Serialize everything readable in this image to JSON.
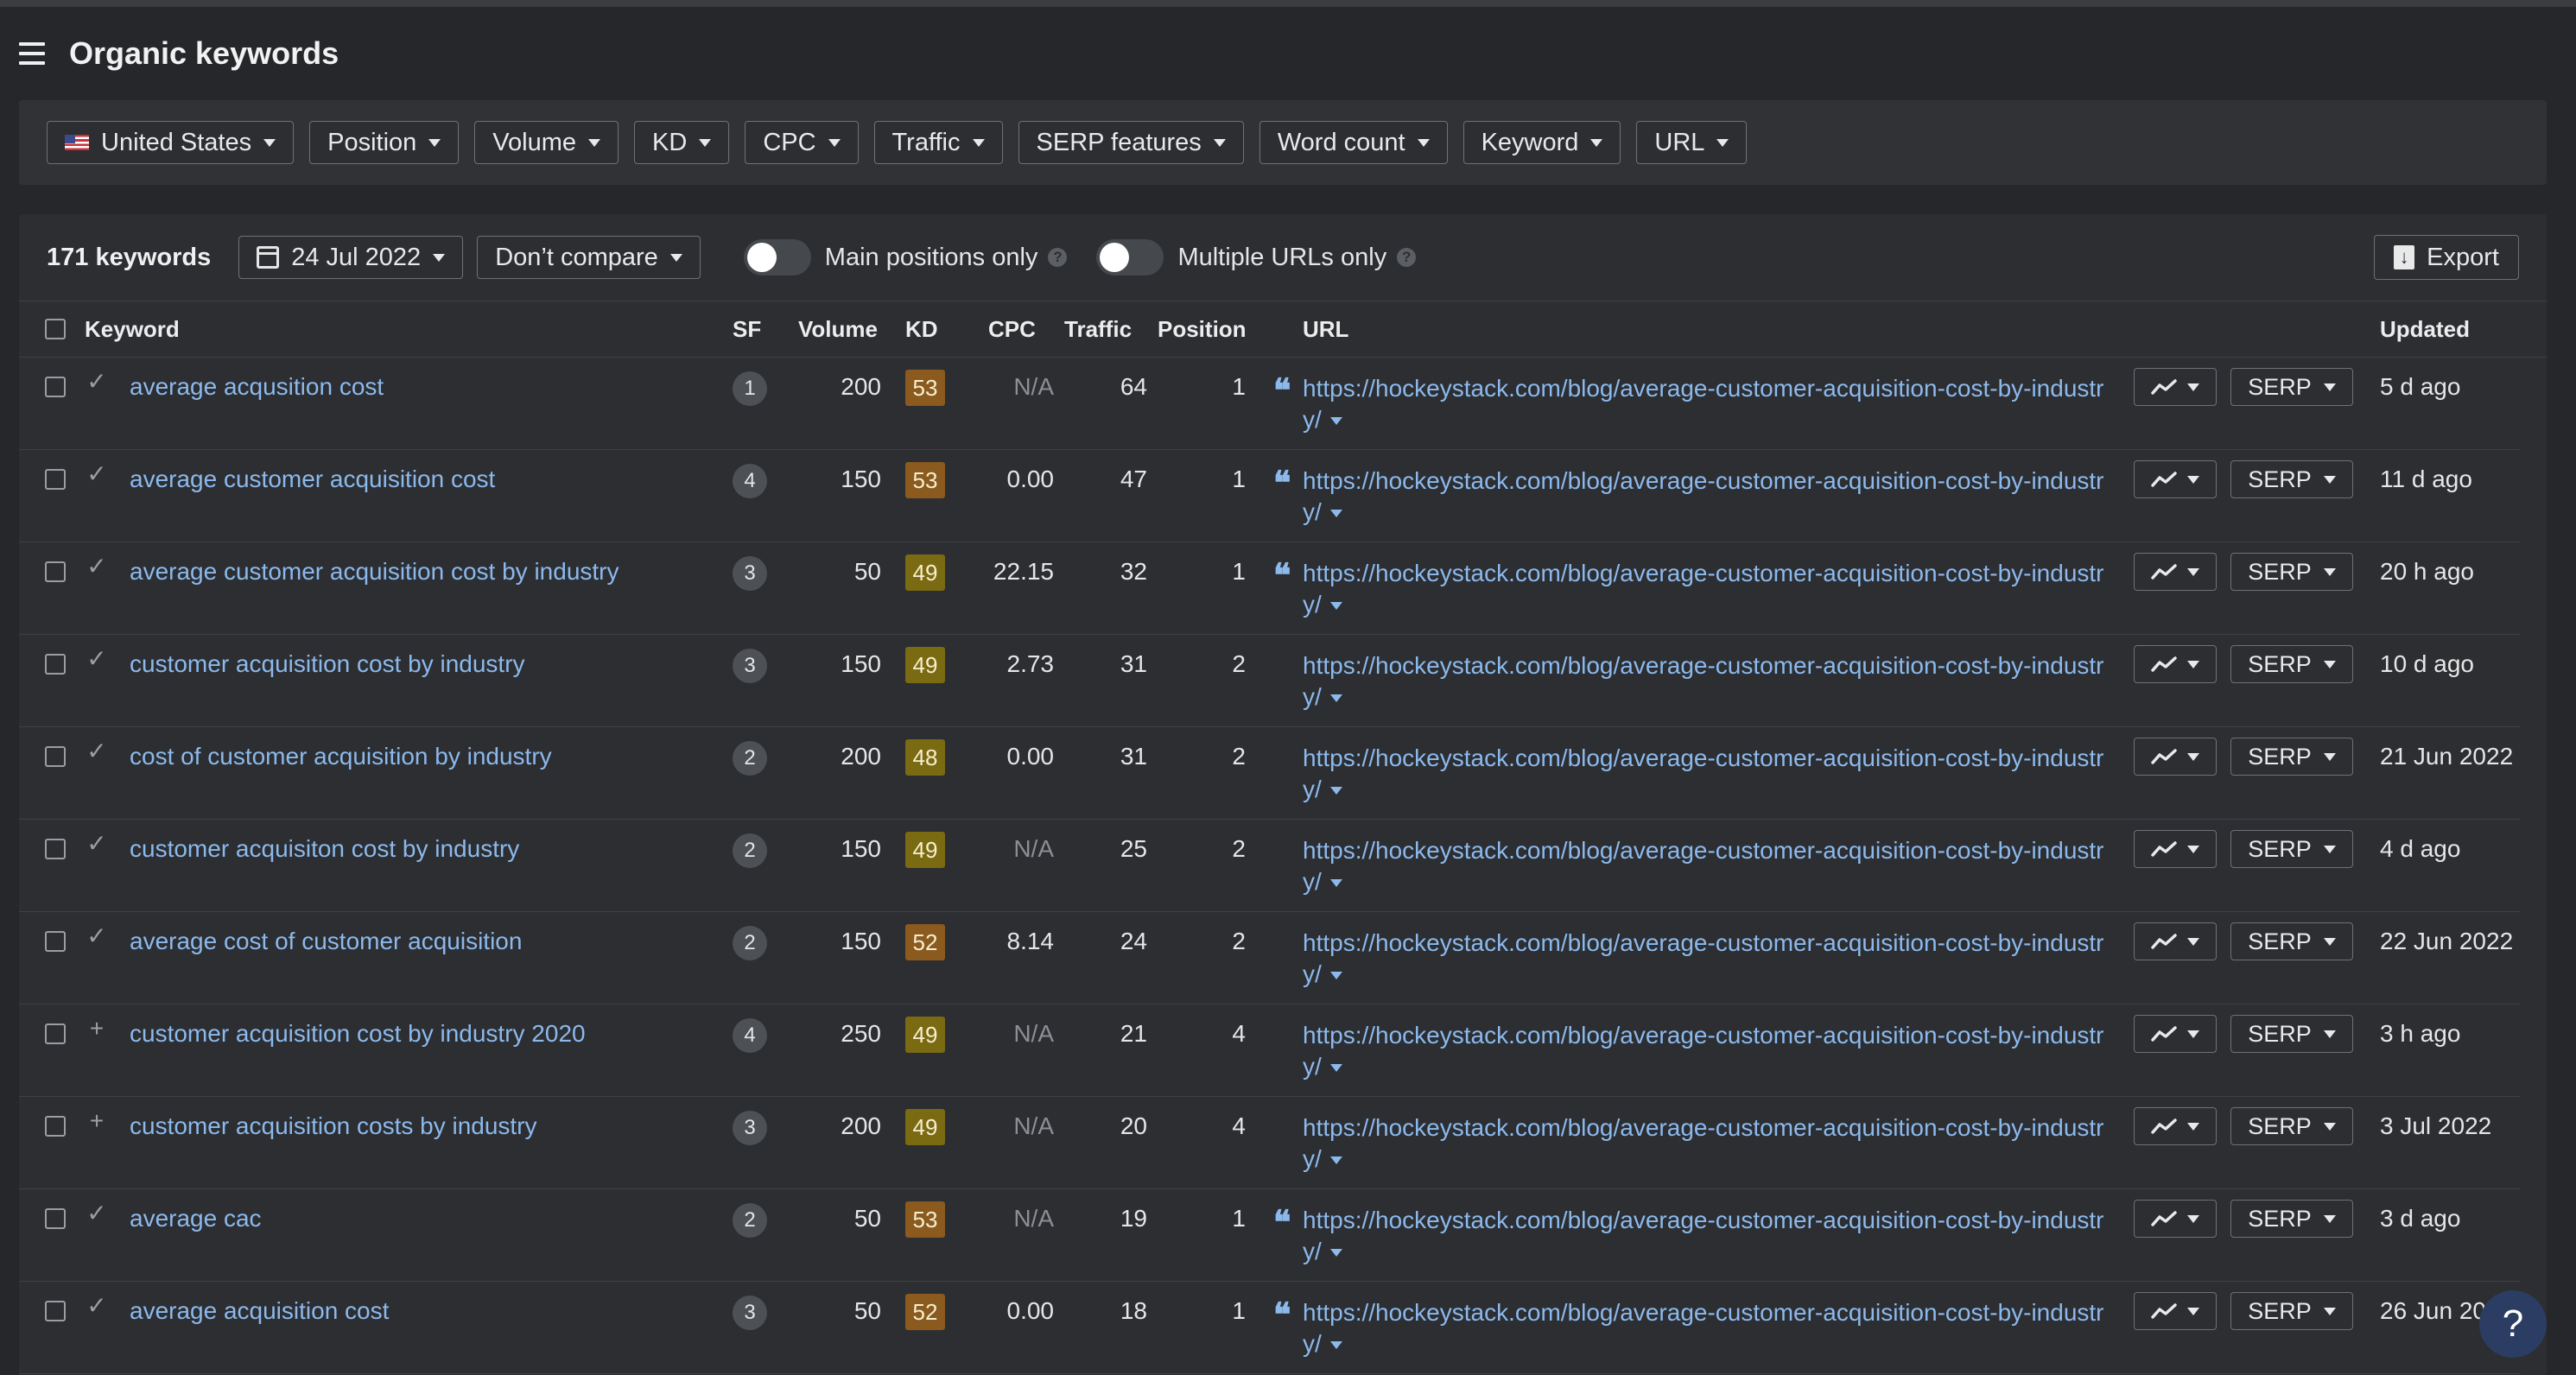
{
  "header": {
    "title": "Organic keywords"
  },
  "filters": [
    "United States",
    "Position",
    "Volume",
    "KD",
    "CPC",
    "Traffic",
    "SERP features",
    "Word count",
    "Keyword",
    "URL"
  ],
  "toolbar": {
    "keyword_count": "171 keywords",
    "date": "24 Jul 2022",
    "compare": "Don’t compare",
    "main_positions_label": "Main positions only",
    "multiple_urls_label": "Multiple URLs only",
    "export_label": "Export",
    "help_glyph": "?"
  },
  "columns": {
    "keyword": "Keyword",
    "sf": "SF",
    "volume": "Volume",
    "kd": "KD",
    "cpc": "CPC",
    "traffic": "Traffic",
    "position": "Position",
    "url": "URL",
    "updated": "Updated"
  },
  "serp_label": "SERP",
  "help_fab": "?",
  "colors": {
    "kd_high": "#8a5a1e",
    "kd_mid": "#7a6a12",
    "link": "#8cb9ec",
    "background": "#25272b"
  },
  "rows": [
    {
      "mark": "✓",
      "keyword": "average acqusition cost",
      "sf": "1",
      "volume": "200",
      "kd": "53",
      "kd_level": "high",
      "cpc": "N/A",
      "traffic": "64",
      "position": "1",
      "quote": "❝",
      "url": "https://hockeystack.com/blog/average-customer-acquisition-cost-by-industry/",
      "updated": "5 d ago"
    },
    {
      "mark": "✓",
      "keyword": "average customer acquisition cost",
      "sf": "4",
      "volume": "150",
      "kd": "53",
      "kd_level": "high",
      "cpc": "0.00",
      "traffic": "47",
      "position": "1",
      "quote": "❝",
      "url": "https://hockeystack.com/blog/average-customer-acquisition-cost-by-industry/",
      "updated": "11 d ago"
    },
    {
      "mark": "✓",
      "keyword": "average customer acquisition cost by industry",
      "sf": "3",
      "volume": "50",
      "kd": "49",
      "kd_level": "mid",
      "cpc": "22.15",
      "traffic": "32",
      "position": "1",
      "quote": "❝",
      "url": "https://hockeystack.com/blog/average-customer-acquisition-cost-by-industry/",
      "updated": "20 h ago"
    },
    {
      "mark": "✓",
      "keyword": "customer acquisition cost by industry",
      "sf": "3",
      "volume": "150",
      "kd": "49",
      "kd_level": "mid",
      "cpc": "2.73",
      "traffic": "31",
      "position": "2",
      "quote": "",
      "url": "https://hockeystack.com/blog/average-customer-acquisition-cost-by-industry/",
      "updated": "10 d ago"
    },
    {
      "mark": "✓",
      "keyword": "cost of customer acquisition by industry",
      "sf": "2",
      "volume": "200",
      "kd": "48",
      "kd_level": "mid",
      "cpc": "0.00",
      "traffic": "31",
      "position": "2",
      "quote": "",
      "url": "https://hockeystack.com/blog/average-customer-acquisition-cost-by-industry/",
      "updated": "21 Jun 2022"
    },
    {
      "mark": "✓",
      "keyword": "customer acquisiton cost by industry",
      "sf": "2",
      "volume": "150",
      "kd": "49",
      "kd_level": "mid",
      "cpc": "N/A",
      "traffic": "25",
      "position": "2",
      "quote": "",
      "url": "https://hockeystack.com/blog/average-customer-acquisition-cost-by-industry/",
      "updated": "4 d ago"
    },
    {
      "mark": "✓",
      "keyword": "average cost of customer acquisition",
      "sf": "2",
      "volume": "150",
      "kd": "52",
      "kd_level": "high",
      "cpc": "8.14",
      "traffic": "24",
      "position": "2",
      "quote": "",
      "url": "https://hockeystack.com/blog/average-customer-acquisition-cost-by-industry/",
      "updated": "22 Jun 2022"
    },
    {
      "mark": "+",
      "keyword": "customer acquisition cost by industry 2020",
      "sf": "4",
      "volume": "250",
      "kd": "49",
      "kd_level": "mid",
      "cpc": "N/A",
      "traffic": "21",
      "position": "4",
      "quote": "",
      "url": "https://hockeystack.com/blog/average-customer-acquisition-cost-by-industry/",
      "updated": "3 h ago"
    },
    {
      "mark": "+",
      "keyword": "customer acquisition costs by industry",
      "sf": "3",
      "volume": "200",
      "kd": "49",
      "kd_level": "mid",
      "cpc": "N/A",
      "traffic": "20",
      "position": "4",
      "quote": "",
      "url": "https://hockeystack.com/blog/average-customer-acquisition-cost-by-industry/",
      "updated": "3 Jul 2022"
    },
    {
      "mark": "✓",
      "keyword": "average cac",
      "sf": "2",
      "volume": "50",
      "kd": "53",
      "kd_level": "high",
      "cpc": "N/A",
      "traffic": "19",
      "position": "1",
      "quote": "❝",
      "url": "https://hockeystack.com/blog/average-customer-acquisition-cost-by-industry/",
      "updated": "3 d ago"
    },
    {
      "mark": "✓",
      "keyword": "average acquisition cost",
      "sf": "3",
      "volume": "50",
      "kd": "52",
      "kd_level": "high",
      "cpc": "0.00",
      "traffic": "18",
      "position": "1",
      "quote": "❝",
      "url": "https://hockeystack.com/blog/average-customer-acquisition-cost-by-industry/",
      "updated": "26 Jun 2022"
    }
  ]
}
